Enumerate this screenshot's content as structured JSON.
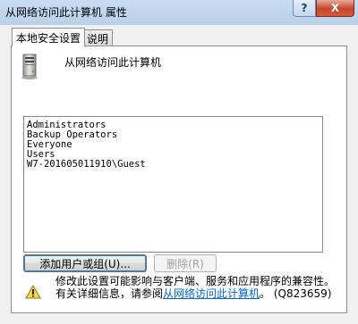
{
  "window": {
    "title": "从网络访问此计算机 属性",
    "help_button": "?",
    "close_button": "X"
  },
  "tabs": [
    {
      "label": "本地安全设置",
      "active": true
    },
    {
      "label": "说明",
      "active": false
    }
  ],
  "policy": {
    "name": "从网络访问此计算机",
    "icon": "computer-icon"
  },
  "accounts": [
    "Administrators",
    "Backup Operators",
    "Everyone",
    "Users",
    "W7-201605011910\\Guest"
  ],
  "buttons": {
    "add": "添加用户或组(U)...",
    "remove": "删除(R)"
  },
  "warning": {
    "icon": "warning-icon",
    "line1": "修改此设置可能影响与客户端、服务和应用程序的兼容性。",
    "line2_prefix": "有关详细信息，请参阅",
    "link": "从网络访问此计算机",
    "line2_suffix": "。 (Q823659)"
  },
  "colors": {
    "titlebar": "#c8dcf1",
    "close": "#c8432b",
    "link": "#0066cc"
  }
}
